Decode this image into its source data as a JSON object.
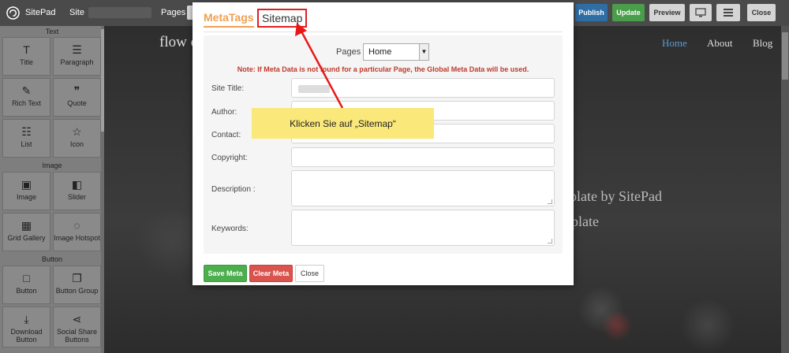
{
  "topbar": {
    "brand": "SitePad",
    "site_label": "Site",
    "pages_label": "Pages :",
    "publish": "Publish",
    "update": "Update",
    "preview": "Preview",
    "close": "Close"
  },
  "sidebar": {
    "sections": [
      "Text",
      "Image",
      "Button"
    ],
    "tiles": [
      {
        "label": "Title",
        "icon": "T"
      },
      {
        "label": "Paragraph",
        "icon": "☰"
      },
      {
        "label": "Rich Text",
        "icon": "✎"
      },
      {
        "label": "Quote",
        "icon": "❞"
      },
      {
        "label": "List",
        "icon": "☷"
      },
      {
        "label": "Icon",
        "icon": "☆"
      },
      {
        "label": "Image",
        "icon": "▣"
      },
      {
        "label": "Slider",
        "icon": "◧"
      },
      {
        "label": "Grid Gallery",
        "icon": "▦"
      },
      {
        "label": "Image Hotspot",
        "icon": "◌"
      },
      {
        "label": "Button",
        "icon": "□"
      },
      {
        "label": "Button Group",
        "icon": "❐"
      },
      {
        "label": "Download Button",
        "icon": "⤓"
      },
      {
        "label": "Social Share Buttons",
        "icon": "⋖"
      }
    ]
  },
  "website": {
    "logo": "flow c",
    "nav": {
      "home": "Home",
      "about": "About",
      "blog": "Blog"
    },
    "hero_line1": "plate by SitePad",
    "hero_line2": "plate"
  },
  "modal": {
    "tab_meta": "MetaTags",
    "tab_sitemap": "Sitemap",
    "pages_label": "Pages :",
    "pages_selected": "Home",
    "note": "Note: If Meta Data is not found for a particular Page, the Global Meta Data will be used.",
    "fields": {
      "site_title": "Site Title:",
      "author": "Author:",
      "contact": "Contact:",
      "copyright": "Copyright:",
      "description": "Description :",
      "keywords": "Keywords:"
    },
    "save_meta": "Save Meta",
    "clear_meta": "Clear Meta",
    "close": "Close"
  },
  "callout": {
    "text": "Klicken Sie auf „Sitemap“"
  },
  "colors": {
    "accent": "#f0a050",
    "highlight": "#e02020",
    "callout": "#fbe87a"
  }
}
